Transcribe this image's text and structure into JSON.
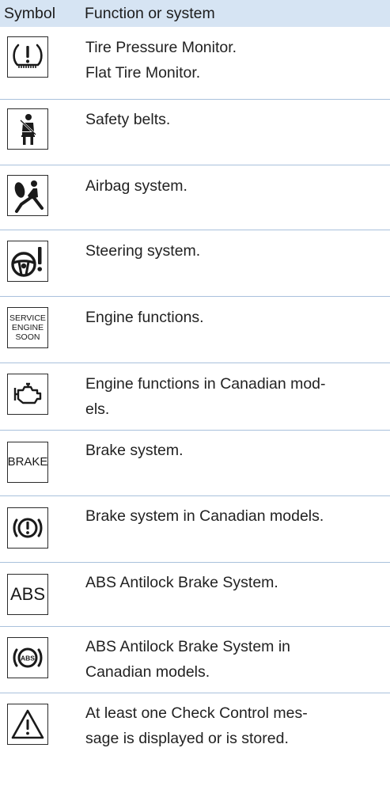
{
  "header": {
    "symbol_label": "Symbol",
    "function_label": "Function or system"
  },
  "rows": [
    {
      "icon": "tire-pressure-icon",
      "lines": [
        "Tire Pressure Monitor.",
        "Flat Tire Monitor."
      ]
    },
    {
      "icon": "seat-belt-icon",
      "lines": [
        "Safety belts."
      ]
    },
    {
      "icon": "airbag-icon",
      "lines": [
        "Airbag system."
      ]
    },
    {
      "icon": "steering-warning-icon",
      "lines": [
        "Steering system."
      ]
    },
    {
      "icon": "service-engine-soon-icon",
      "icon_text": [
        "SERVICE",
        "ENGINE",
        "SOON"
      ],
      "lines": [
        "Engine functions."
      ]
    },
    {
      "icon": "check-engine-icon",
      "lines": [
        "Engine functions in Canadian mod-",
        "els."
      ]
    },
    {
      "icon": "brake-text-icon",
      "icon_text": [
        "BRAKE"
      ],
      "lines": [
        "Brake system."
      ]
    },
    {
      "icon": "brake-warning-icon",
      "lines": [
        "Brake system in Canadian models."
      ]
    },
    {
      "icon": "abs-text-icon",
      "icon_text": [
        "ABS"
      ],
      "lines": [
        "ABS Antilock Brake System."
      ]
    },
    {
      "icon": "abs-circle-icon",
      "icon_text": [
        "ABS"
      ],
      "lines": [
        "ABS Antilock Brake System in",
        "Canadian models."
      ]
    },
    {
      "icon": "warning-triangle-icon",
      "lines": [
        "At least one Check Control mes-",
        "sage is displayed or is stored."
      ]
    }
  ]
}
